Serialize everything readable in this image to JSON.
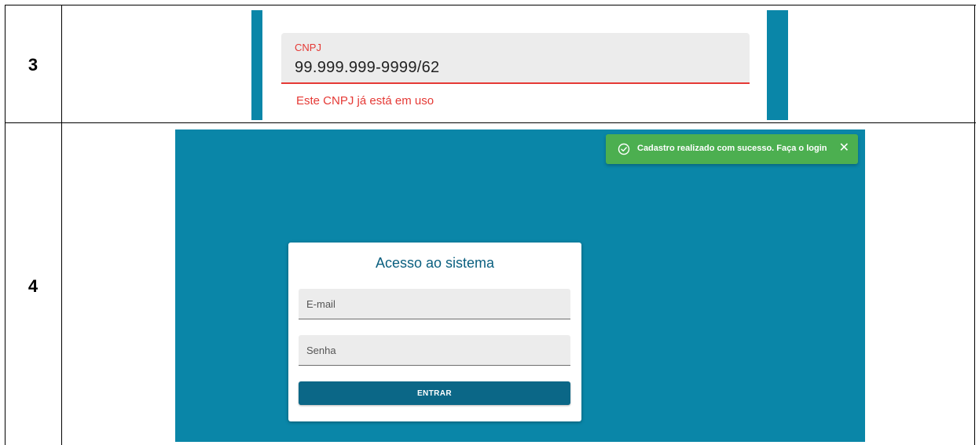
{
  "rows": [
    {
      "number": "3"
    },
    {
      "number": "4"
    }
  ],
  "cnpj_field": {
    "label": "CNPJ",
    "value": "99.999.999-9999/62",
    "error": "Este CNPJ já está em uso"
  },
  "toast": {
    "message": "Cadastro realizado com sucesso. Faça o login",
    "close_symbol": "✕",
    "icon": "check-circle-icon"
  },
  "login": {
    "title": "Acesso ao sistema",
    "email_placeholder": "E-mail",
    "senha_placeholder": "Senha",
    "button_label": "ENTRAR"
  },
  "colors": {
    "brand_teal": "#0a86a8",
    "button": "#0b6787",
    "error": "#e53935",
    "toast_success": "#4caf50"
  }
}
